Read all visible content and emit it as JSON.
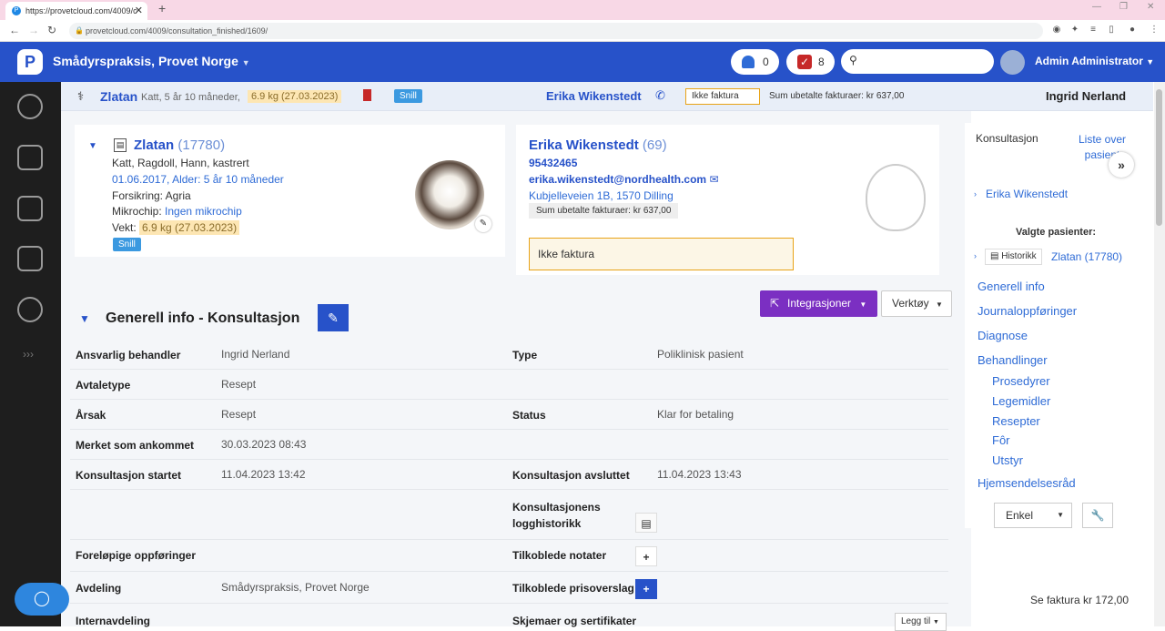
{
  "browser": {
    "tab_title": "https://provetcloud.com/4009/c",
    "tab_close": "✕",
    "new_tab": "+",
    "url": "provetcloud.com/4009/consultation_finished/1609/"
  },
  "header": {
    "logo": "P",
    "clinic": "Smådyrspraksis, Provet Norge",
    "notifications_count": "0",
    "tasks_count": "8",
    "search_placeholder": "",
    "user": "Admin Administrator"
  },
  "strip": {
    "patient_name": "Zlatan",
    "patient_info": "Katt, 5 år 10 måneder,",
    "weight": "6.9 kg (27.03.2023)",
    "tag": "Snill",
    "owner": "Erika Wikenstedt",
    "invoice_flag": "Ikke faktura",
    "unpaid": "Sum ubetalte fakturaer: kr 637,00",
    "vet": "Ingrid Nerland"
  },
  "patient": {
    "name": "Zlatan",
    "id": "(17780)",
    "species": "Katt, Ragdoll, Hann, kastrert",
    "birth": "01.06.2017, Alder: 5 år 10 måneder",
    "insurance": "Forsikring: Agria",
    "chip_label": "Mikrochip:",
    "chip_value": "Ingen mikrochip",
    "weight_label": "Vekt:",
    "weight_value": "6.9 kg (27.03.2023)",
    "tag": "Snill"
  },
  "owner": {
    "name": "Erika Wikenstedt",
    "id": "(69)",
    "phone": "95432465",
    "email": "erika.wikenstedt@nordhealth.com",
    "address": "Kubjelleveien 1B, 1570 Dilling",
    "unpaid": "Sum ubetalte fakturaer: kr 637,00",
    "note": "Ikke faktura"
  },
  "actions": {
    "integrations": "Integrasjoner",
    "tools": "Verktøy"
  },
  "section": {
    "title": "Generell info - Konsultasjon",
    "rows": [
      {
        "l1": "Ansvarlig behandler",
        "v1": "Ingrid Nerland",
        "l2": "Type",
        "v2": "Poliklinisk pasient"
      },
      {
        "l1": "Avtaletype",
        "v1": "Resept",
        "l2": "",
        "v2": ""
      },
      {
        "l1": "Årsak",
        "v1": "Resept",
        "l2": "Status",
        "v2": "Klar for betaling"
      },
      {
        "l1": "Merket som ankommet",
        "v1": "30.03.2023 08:43",
        "l2": "",
        "v2": ""
      },
      {
        "l1": "Konsultasjon startet",
        "v1": "11.04.2023 13:42",
        "l2": "Konsultasjon avsluttet",
        "v2": "11.04.2023 13:43"
      },
      {
        "l1": "",
        "v1": "",
        "l2": "Konsultasjonens logghistorikk",
        "v2": ""
      },
      {
        "l1": "Foreløpige oppføringer",
        "v1": "",
        "l2": "Tilkoblede notater",
        "v2": ""
      },
      {
        "l1": "Avdeling",
        "v1": "Smådyrspraksis, Provet Norge",
        "l2": "Tilkoblede prisoverslag",
        "v2": ""
      },
      {
        "l1": "Internavdeling",
        "v1": "",
        "l2": "Skjemaer og sertifikater",
        "v2": ""
      }
    ],
    "add_button": "Legg til"
  },
  "right": {
    "tab1": "Konsultasjon",
    "tab2": "Liste over pasient",
    "owner_link": "Erika Wikenstedt",
    "selected_label": "Valgte pasienter:",
    "history_btn": "Historikk",
    "patient_link": "Zlatan (17780)",
    "nav": [
      "Generell info",
      "Journaloppføringer",
      "Diagnose",
      "Behandlinger"
    ],
    "subnav": [
      "Prosedyrer",
      "Legemidler",
      "Resepter",
      "Fôr",
      "Utstyr"
    ],
    "last": "Hjemsendelsesråd",
    "select": "Enkel"
  },
  "footer": {
    "see_invoice": "Se faktura kr 172,00"
  }
}
